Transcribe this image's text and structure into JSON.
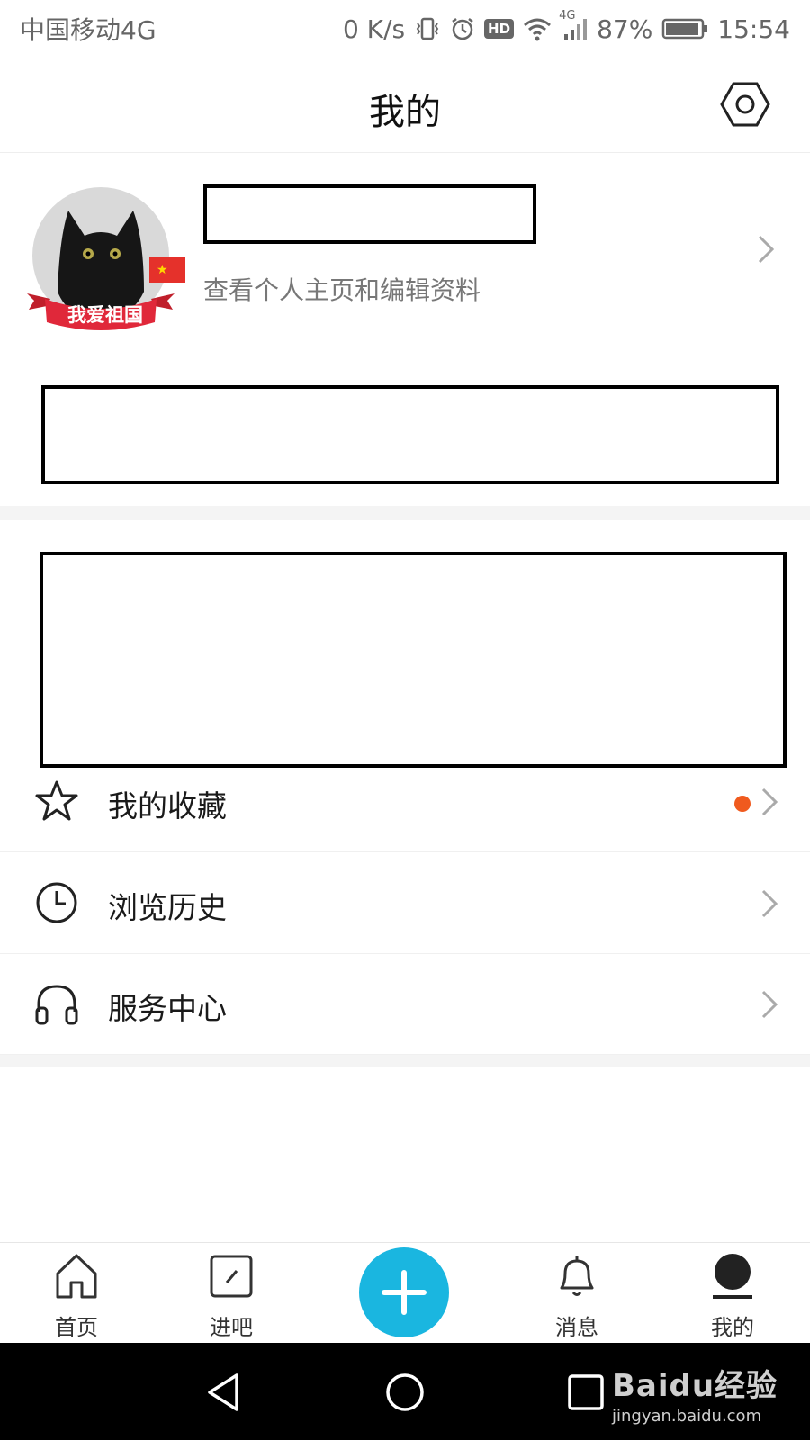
{
  "status_bar": {
    "carrier": "中国移动4G",
    "net_speed": "0 K/s",
    "hd_badge": "HD",
    "signal_label": "4G",
    "battery": "87%",
    "time": "15:54"
  },
  "header": {
    "title": "我的"
  },
  "profile": {
    "subtitle": "查看个人主页和编辑资料",
    "avatar_badge": "我爱祖国"
  },
  "menu": [
    {
      "label": "我的收藏",
      "icon": "star-icon",
      "has_dot": true
    },
    {
      "label": "浏览历史",
      "icon": "clock-icon"
    },
    {
      "label": "服务中心",
      "icon": "headphones-icon"
    }
  ],
  "tabbar": {
    "home": "首页",
    "post": "进吧",
    "messages": "消息",
    "mine": "我的"
  },
  "watermark": {
    "brand": "Baidu经验",
    "url": "jingyan.baidu.com"
  },
  "colors": {
    "accent": "#1ab6e0",
    "dot": "#f05a1e"
  }
}
